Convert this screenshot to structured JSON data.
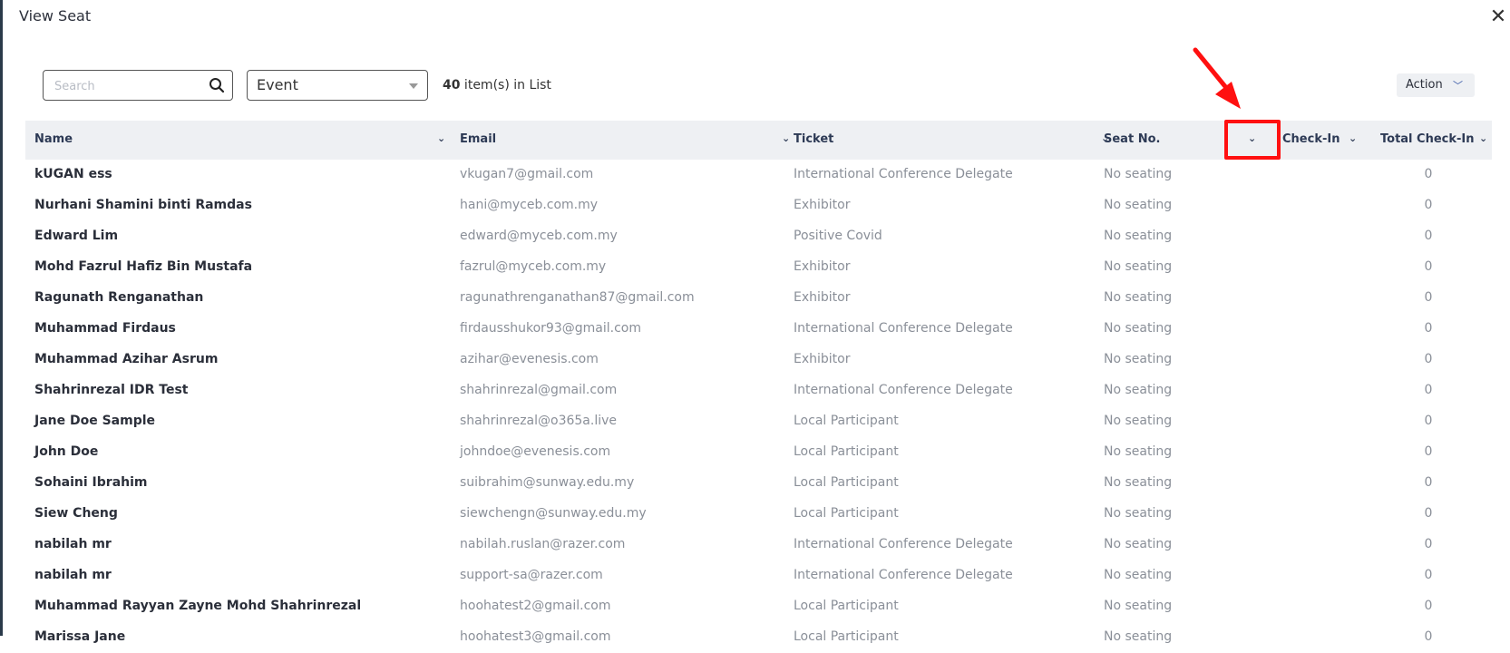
{
  "modal": {
    "title": "View Seat",
    "close_glyph": "✕"
  },
  "toolbar": {
    "search_placeholder": "Search",
    "event_select": "Event",
    "item_count": "40",
    "item_count_suffix": " item(s) in List",
    "action_label": "Action"
  },
  "columns": [
    {
      "label": "Name"
    },
    {
      "label": "Email"
    },
    {
      "label": "Ticket"
    },
    {
      "label": "Seat No."
    },
    {
      "label": ""
    },
    {
      "label": "Check-In"
    },
    {
      "label": "Total Check-In"
    }
  ],
  "rows": [
    {
      "name": "kUGAN ess",
      "email": "vkugan7@gmail.com",
      "ticket": "International Conference Delegate",
      "seat": "No seating",
      "total": "0"
    },
    {
      "name": "Nurhani Shamini binti Ramdas",
      "email": "hani@myceb.com.my",
      "ticket": "Exhibitor",
      "seat": "No seating",
      "total": "0"
    },
    {
      "name": "Edward Lim",
      "email": "edward@myceb.com.my",
      "ticket": "Positive Covid",
      "seat": "No seating",
      "total": "0"
    },
    {
      "name": "Mohd Fazrul Hafiz Bin Mustafa",
      "email": "fazrul@myceb.com.my",
      "ticket": "Exhibitor",
      "seat": "No seating",
      "total": "0"
    },
    {
      "name": "Ragunath Renganathan",
      "email": "ragunathrenganathan87@gmail.com",
      "ticket": "Exhibitor",
      "seat": "No seating",
      "total": "0"
    },
    {
      "name": "Muhammad Firdaus",
      "email": "firdausshukor93@gmail.com",
      "ticket": "International Conference Delegate",
      "seat": "No seating",
      "total": "0"
    },
    {
      "name": "Muhammad Azihar Asrum",
      "email": "azihar@evenesis.com",
      "ticket": "Exhibitor",
      "seat": "No seating",
      "total": "0"
    },
    {
      "name": "Shahrinrezal IDR Test",
      "email": "shahrinrezal@gmail.com",
      "ticket": "International Conference Delegate",
      "seat": "No seating",
      "total": "0"
    },
    {
      "name": "Jane Doe Sample",
      "email": "shahrinrezal@o365a.live",
      "ticket": "Local Participant",
      "seat": "No seating",
      "total": "0"
    },
    {
      "name": "John Doe",
      "email": "johndoe@evenesis.com",
      "ticket": "Local Participant",
      "seat": "No seating",
      "total": "0"
    },
    {
      "name": "Sohaini Ibrahim",
      "email": "suibrahim@sunway.edu.my",
      "ticket": "Local Participant",
      "seat": "No seating",
      "total": "0"
    },
    {
      "name": "Siew Cheng",
      "email": "siewchengn@sunway.edu.my",
      "ticket": "Local Participant",
      "seat": "No seating",
      "total": "0"
    },
    {
      "name": "nabilah mr",
      "email": "nabilah.ruslan@razer.com",
      "ticket": "International Conference Delegate",
      "seat": "No seating",
      "total": "0"
    },
    {
      "name": "nabilah mr",
      "email": "support-sa@razer.com",
      "ticket": "International Conference Delegate",
      "seat": "No seating",
      "total": "0"
    },
    {
      "name": "Muhammad Rayyan Zayne Mohd Shahrinrezal",
      "email": "hoohatest2@gmail.com",
      "ticket": "Local Participant",
      "seat": "No seating",
      "total": "0"
    },
    {
      "name": "Marissa Jane",
      "email": "hoohatest3@gmail.com",
      "ticket": "Local Participant",
      "seat": "No seating",
      "total": "0"
    }
  ],
  "colors": {
    "header_bg": "#eef0f3",
    "highlight": "#ff1010",
    "muted_text": "#8a8f98"
  }
}
